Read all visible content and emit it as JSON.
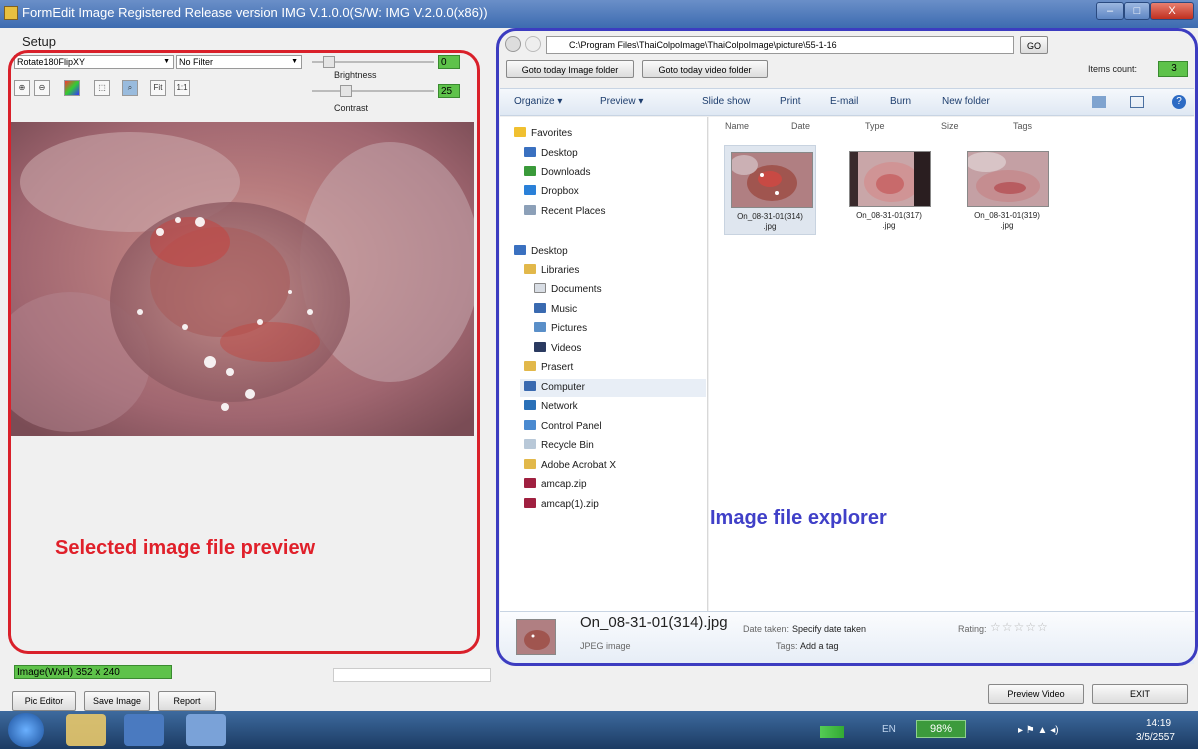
{
  "window": {
    "title": "FormEdit Image Registered Release version IMG V.1.0.0(S/W: IMG V.2.0.0(x86))",
    "controls": [
      "–",
      "□",
      "X"
    ]
  },
  "menu": {
    "setup": "Setup"
  },
  "left": {
    "rotate_select": "Rotate180FlipXY",
    "filter_select": "No Filter",
    "brightness_label": "Brightness",
    "brightness_value": "0",
    "brightness_level": 0.1,
    "contrast_label": "Contrast",
    "contrast_value": "25",
    "contrast_level": 0.25,
    "tool_labels": [
      "Fit",
      "1:1"
    ],
    "status_size": "Image(WxH) 352 x 240",
    "buttons": {
      "pic_editor": "Pic Editor",
      "save_image": "Save Image",
      "report": "Report"
    },
    "annotation": "Selected image file preview"
  },
  "explorer": {
    "go_button": "GO",
    "path": "C:\\Program Files\\ThaiColpoImage\\ThaiColpoImage\\picture\\55-1-16",
    "goto_image": "Goto today Image folder",
    "goto_video": "Goto today video folder",
    "items_count_label": "Items count:",
    "items_count_value": "3",
    "toolbar": [
      "Organize ▾",
      "Preview ▾",
      "Slide show",
      "Print",
      "E-mail",
      "Burn",
      "New folder"
    ],
    "nav": {
      "favorites": [
        "Favorites",
        "Desktop",
        "Downloads",
        "Dropbox",
        "Recent Places"
      ],
      "tree": [
        "Desktop",
        "Libraries",
        "Documents",
        "Music",
        "Pictures",
        "Videos",
        "Prasert",
        "Computer",
        "Network",
        "Control Panel",
        "Recycle Bin",
        "Adobe Acrobat X",
        "amcap.zip",
        "amcap(1).zip"
      ]
    },
    "columns": [
      "Name",
      "Date",
      "Type",
      "Size",
      "Tags"
    ],
    "files": [
      {
        "name": "On_08-31-01(314)",
        "ext": ".jpg"
      },
      {
        "name": "On_08-31-01(317)",
        "ext": ".jpg"
      },
      {
        "name": "On_08-31-01(319)",
        "ext": ".jpg"
      }
    ],
    "details": {
      "filename": "On_08-31-01(314).jpg",
      "filetype": "JPEG image",
      "date_taken_label": "Date taken:",
      "date_taken_value": "Specify date taken",
      "tags_label": "Tags:",
      "tags_value": "Add a tag",
      "rating_label": "Rating:",
      "rating_stars": "☆☆☆☆☆"
    },
    "annotation": "Image file explorer"
  },
  "bottom": {
    "preview_video": "Preview Video",
    "exit": "EXIT"
  },
  "taskbar": {
    "battery": "98%",
    "lang": "EN",
    "time": "14:19",
    "date": "3/5/2557"
  },
  "colors": {
    "red_annotation": "#d9202a",
    "blue_annotation": "#3c3cc0",
    "status_green": "#5ec24a"
  }
}
